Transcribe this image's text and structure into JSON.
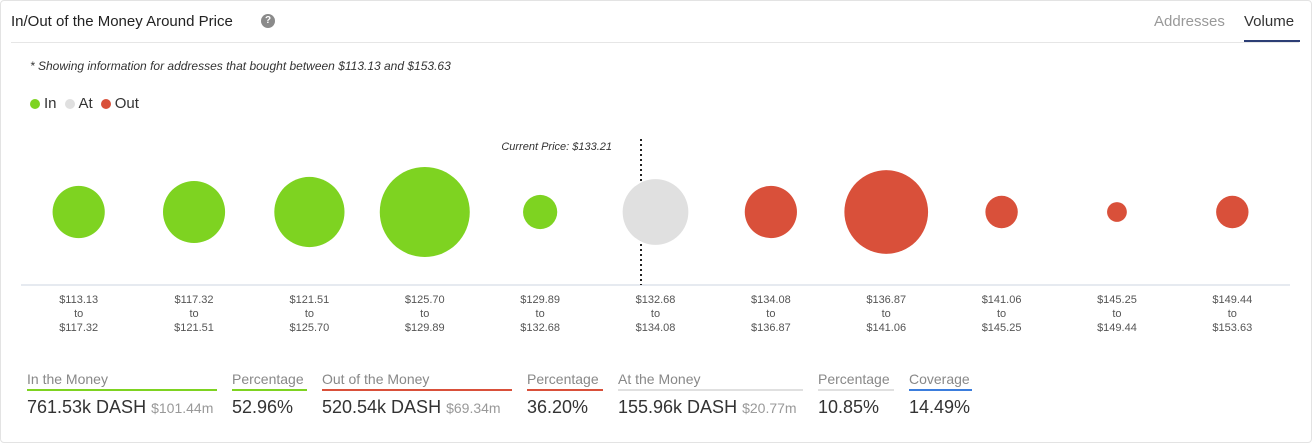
{
  "header": {
    "title": "In/Out of the Money Around Price",
    "help_icon": "?",
    "tabs": [
      {
        "label": "Addresses",
        "active": false
      },
      {
        "label": "Volume",
        "active": true
      }
    ]
  },
  "note": "* Showing information for addresses that bought between $113.13 and $153.63",
  "legend": [
    {
      "label": "In",
      "color": "#7ed321"
    },
    {
      "label": "At",
      "color": "#e0e0e0"
    },
    {
      "label": "Out",
      "color": "#d9503a"
    }
  ],
  "current_price_label": "Current Price: $133.21",
  "colors": {
    "in": "#7ed321",
    "at": "#e0e0e0",
    "out": "#d9503a"
  },
  "buckets": [
    {
      "from": "$113.13",
      "to": "$117.32",
      "status": "in",
      "relative_size": 0.58
    },
    {
      "from": "$117.32",
      "to": "$121.51",
      "status": "in",
      "relative_size": 0.69
    },
    {
      "from": "$121.51",
      "to": "$125.70",
      "status": "in",
      "relative_size": 0.78
    },
    {
      "from": "$125.70",
      "to": "$129.89",
      "status": "in",
      "relative_size": 1.0
    },
    {
      "from": "$129.89",
      "to": "$132.68",
      "status": "in",
      "relative_size": 0.38
    },
    {
      "from": "$132.68",
      "to": "$134.08",
      "status": "at",
      "relative_size": 0.73
    },
    {
      "from": "$134.08",
      "to": "$136.87",
      "status": "out",
      "relative_size": 0.58
    },
    {
      "from": "$136.87",
      "to": "$141.06",
      "status": "out",
      "relative_size": 0.93
    },
    {
      "from": "$141.06",
      "to": "$145.25",
      "status": "out",
      "relative_size": 0.36
    },
    {
      "from": "$145.25",
      "to": "$149.44",
      "status": "out",
      "relative_size": 0.22
    },
    {
      "from": "$149.44",
      "to": "$153.63",
      "status": "out",
      "relative_size": 0.36
    }
  ],
  "to_word": "to",
  "stats": {
    "in": {
      "label": "In the Money",
      "value": "761.53k DASH",
      "usd": "$101.44m",
      "pct_label": "Percentage",
      "pct": "52.96%"
    },
    "out": {
      "label": "Out of the Money",
      "value": "520.54k DASH",
      "usd": "$69.34m",
      "pct_label": "Percentage",
      "pct": "36.20%"
    },
    "at": {
      "label": "At the Money",
      "value": "155.96k DASH",
      "usd": "$20.77m",
      "pct_label": "Percentage",
      "pct": "10.85%"
    },
    "coverage": {
      "label": "Coverage",
      "value": "14.49%",
      "color": "#3b7ddd"
    }
  }
}
